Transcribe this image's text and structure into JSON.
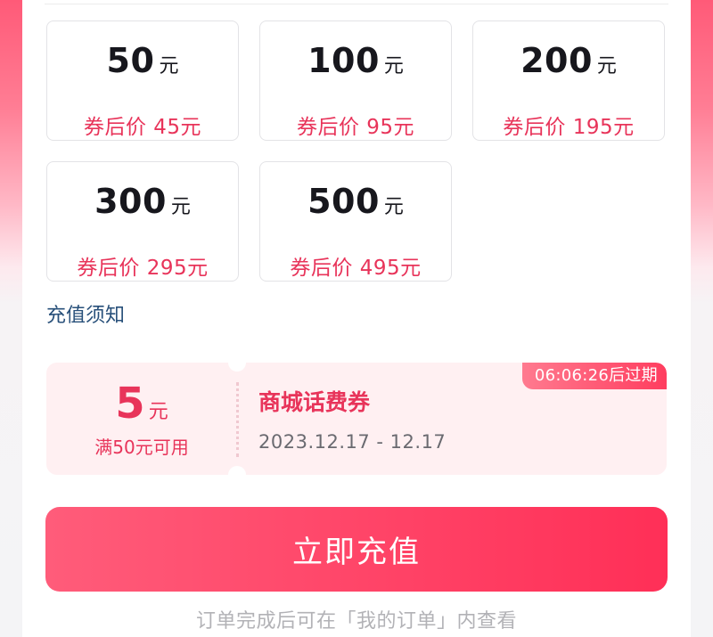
{
  "amount_options": [
    {
      "face_value": "50",
      "unit": "元",
      "discounted_price": "券后价 45元"
    },
    {
      "face_value": "100",
      "unit": "元",
      "discounted_price": "券后价 95元"
    },
    {
      "face_value": "200",
      "unit": "元",
      "discounted_price": "券后价 195元"
    },
    {
      "face_value": "300",
      "unit": "元",
      "discounted_price": "券后价 295元"
    },
    {
      "face_value": "500",
      "unit": "元",
      "discounted_price": "券后价 495元"
    }
  ],
  "recharge_notice_label": "充值须知",
  "coupon": {
    "amount": "5",
    "unit": "元",
    "condition": "满50元可用",
    "name": "商城话费券",
    "validity": "2023.12.17 - 12.17",
    "expire_badge": "06:06:26后过期"
  },
  "cta_label": "立即充值",
  "footnote": "订单完成后可在「我的订单」内查看",
  "colors": {
    "accent": "#e8345a",
    "button_start": "#ff5c7a",
    "button_end": "#ff2f57",
    "coupon_bg": "#fff0f2",
    "link": "#28507a"
  }
}
